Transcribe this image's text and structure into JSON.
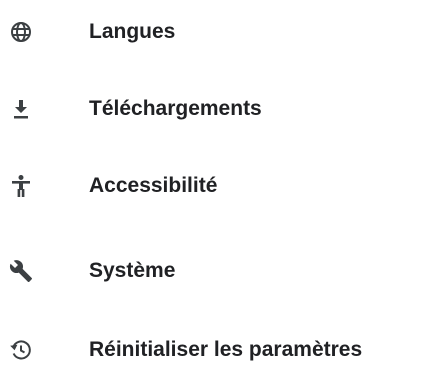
{
  "settings_menu": {
    "items": [
      {
        "label": "Langues",
        "icon": "globe-icon"
      },
      {
        "label": "Téléchargements",
        "icon": "download-icon"
      },
      {
        "label": "Accessibilité",
        "icon": "accessibility-icon"
      },
      {
        "label": "Système",
        "icon": "wrench-icon"
      },
      {
        "label": "Réinitialiser les paramètres",
        "icon": "restore-icon"
      }
    ]
  },
  "colors": {
    "text": "#202124",
    "icon": "#3c4043",
    "background": "#ffffff"
  }
}
